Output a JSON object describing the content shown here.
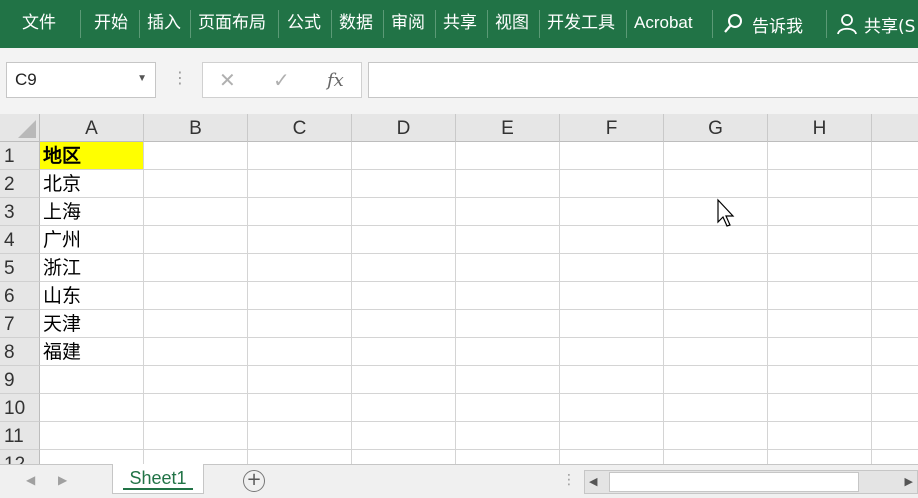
{
  "ribbon": {
    "tabs": [
      "文件",
      "开始",
      "插入",
      "页面布局",
      "公式",
      "数据",
      "审阅",
      "共享",
      "视图",
      "开发工具",
      "Acrobat"
    ],
    "tell_me": "告诉我",
    "share": "共享(S"
  },
  "formula_bar": {
    "name_box": "C9",
    "fx_label": "fx",
    "formula": ""
  },
  "grid": {
    "columns": [
      "A",
      "B",
      "C",
      "D",
      "E",
      "F",
      "G",
      "H"
    ],
    "rows": [
      "1",
      "2",
      "3",
      "4",
      "5",
      "6",
      "7",
      "8",
      "9",
      "10",
      "11",
      "12"
    ],
    "column_a": [
      "地区",
      "北京",
      "上海",
      "广州",
      "浙江",
      "山东",
      "天津",
      "福建"
    ]
  },
  "sheets": {
    "active": "Sheet1"
  },
  "colors": {
    "ribbon": "#217346",
    "header_fill": "#ffff00"
  }
}
